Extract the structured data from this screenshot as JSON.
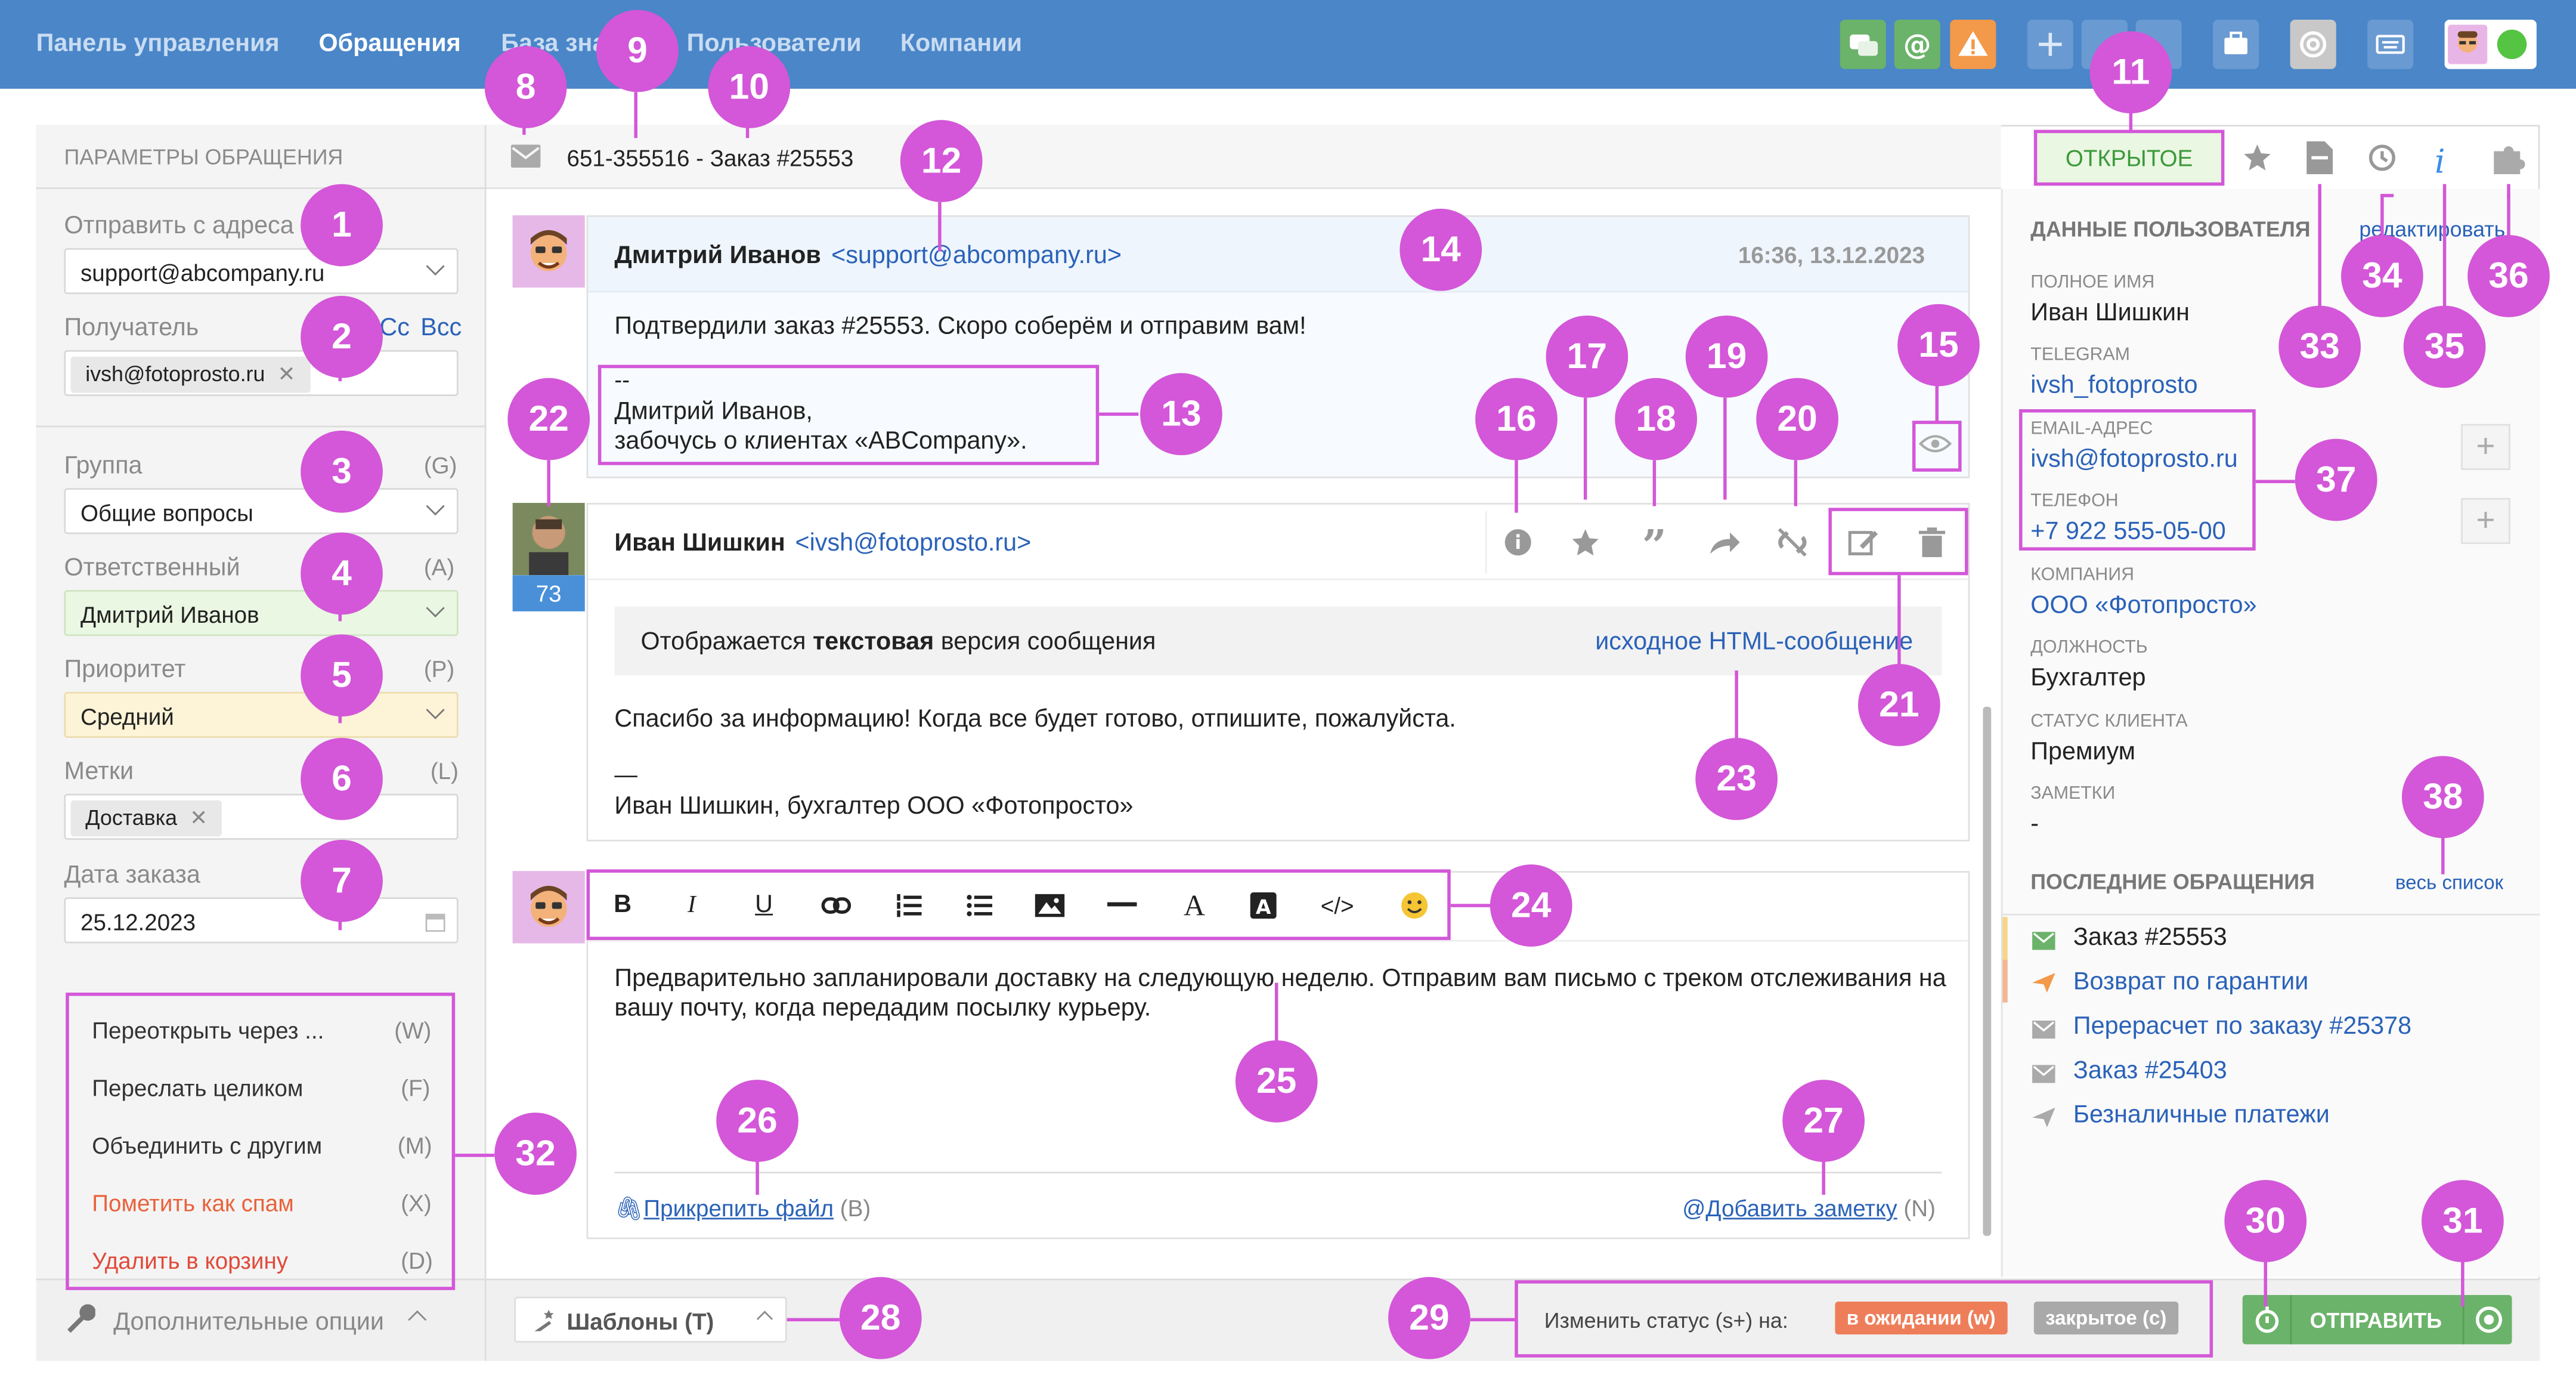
{
  "topnav": {
    "items": [
      "Панель управления",
      "Обращения",
      "База зна",
      "Пользователи",
      "Компании"
    ],
    "active": "Обращения"
  },
  "colors": {
    "topbar": "#4a86c8",
    "green": "#6bb36a",
    "orange": "#f2994a",
    "highlight": "#d357d8",
    "link": "#2a62b8"
  },
  "left": {
    "title": "ПАРАМЕТРЫ ОБРАЩЕНИЯ",
    "from_label": "Отправить с адреса",
    "from_value": "support@abcompany.ru",
    "to_label": "Получатель",
    "cc": "Cc",
    "bcc": "Bcc",
    "to_value": "ivsh@fotoprosto.ru",
    "group_label": "Группа",
    "group_key": "(G)",
    "group_value": "Общие вопросы",
    "assignee_label": "Ответственный",
    "assignee_key": "(A)",
    "assignee_value": "Дмитрий Иванов",
    "priority_label": "Приоритет",
    "priority_key": "(P)",
    "priority_value": "Средний",
    "tags_label": "Метки",
    "tags_key": "(L)",
    "tag_value": "Доставка",
    "date_label": "Дата заказа",
    "date_value": "25.12.2023",
    "actions": [
      {
        "label": "Переоткрыть через ...",
        "key": "(W)"
      },
      {
        "label": "Переслать целиком",
        "key": "(F)"
      },
      {
        "label": "Объединить с другим",
        "key": "(M)"
      },
      {
        "label": "Пометить как спам",
        "key": "(X)"
      },
      {
        "label": "Удалить в корзину",
        "key": "(D)"
      }
    ],
    "more_options": "Дополнительные опции"
  },
  "ticket": {
    "title": "651-355516 - Заказ #25553",
    "status": "ОТКРЫТОЕ"
  },
  "msg1": {
    "author": "Дмитрий Иванов",
    "email": "<support@abcompany.ru>",
    "time": "16:36, 13.12.2023",
    "body": "Подтвердили заказ #25553. Скоро соберём и отправим вам!",
    "sig_dash": "--",
    "sig_name": "Дмитрий Иванов,",
    "sig_role": "забочусь о клиентах «ABCompany»."
  },
  "msg2": {
    "author": "Иван Шишкин",
    "email": "<ivsh@fotoprosto.ru>",
    "count": "73",
    "notice_pre": "Отображается ",
    "notice_bold": "текстовая",
    "notice_post": " версия сообщения",
    "html_link": "исходное HTML-сообщение",
    "body": "Спасибо за информацию! Когда все будет готово, отпишите, пожалуйста.",
    "sig_dash": "—",
    "sig": "Иван Шишкин, бухгалтер ООО «Фотопросто»"
  },
  "reply": {
    "text": "Предварительно запланировали доставку на следующую неделю. Отправим вам письмо с треком отслеживания на вашу почту, когда передадим посылку курьеру.",
    "attach": "Прикрепить файл",
    "attach_key": "(B)",
    "note": "Добавить заметку",
    "note_key": "(N)"
  },
  "bottom": {
    "templates": "Шаблоны (T)",
    "status_prefix": "Изменить статус (s+) на:",
    "pending": "в ожидании (w)",
    "closed": "закрытое (c)",
    "send": "ОТПРАВИТЬ"
  },
  "user": {
    "header": "ДАННЫЕ ПОЛЬЗОВАТЕЛЯ",
    "edit": "редактировать",
    "fullname_label": "ПОЛНОЕ ИМЯ",
    "fullname": "Иван Шишкин",
    "telegram_label": "TELEGRAM",
    "telegram": "ivsh_fotoprosto",
    "email_label": "EMAIL-АДРЕС",
    "email": "ivsh@fotoprosto.ru",
    "phone_label": "ТЕЛЕФОН",
    "phone": "+7 922 555-05-00",
    "company_label": "КОМПАНИЯ",
    "company": "ООО «Фотопросто»",
    "position_label": "ДОЛЖНОСТЬ",
    "position": "Бухгалтер",
    "status_label": "СТАТУС КЛИЕНТА",
    "status": "Премиум",
    "notes_label": "ЗАМЕТКИ",
    "notes": "-",
    "recent_header": "ПОСЛЕДНИЕ ОБРАЩЕНИЯ",
    "all_list": "весь список",
    "recent": [
      "Заказ #25553",
      "Возврат по гарантии",
      "Перерасчет по заказу #25378",
      "Заказ #25403",
      "Безналичные платежи"
    ]
  },
  "callouts": [
    "1",
    "2",
    "3",
    "4",
    "5",
    "6",
    "7",
    "8",
    "9",
    "10",
    "11",
    "12",
    "13",
    "14",
    "15",
    "16",
    "17",
    "18",
    "19",
    "20",
    "21",
    "22",
    "23",
    "24",
    "25",
    "26",
    "27",
    "28",
    "29",
    "30",
    "31",
    "32",
    "33",
    "34",
    "35",
    "36",
    "37",
    "38"
  ]
}
